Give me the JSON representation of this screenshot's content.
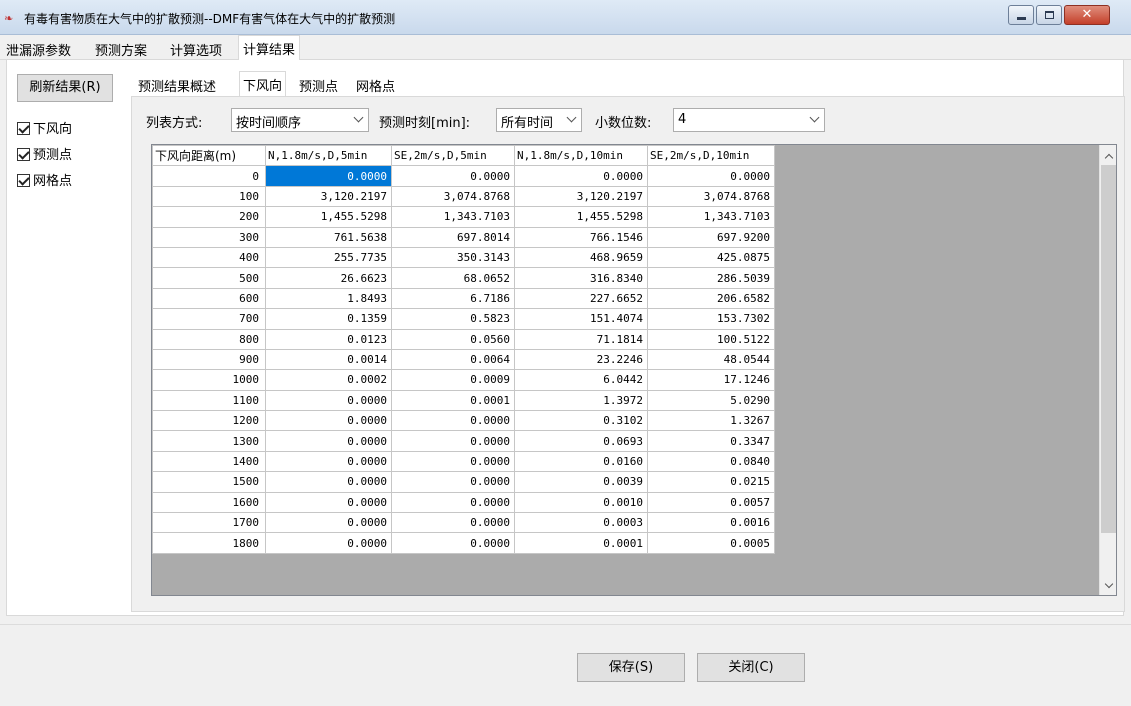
{
  "window": {
    "title": "有毒有害物质在大气中的扩散预测--DMF有害气体在大气中的扩散预测",
    "app_icon": "app-logo-icon",
    "minimize_glyph": "",
    "maximize_glyph": "",
    "close_glyph": "✕"
  },
  "main_tabs": [
    {
      "label": "泄漏源参数"
    },
    {
      "label": "预测方案"
    },
    {
      "label": "计算选项"
    },
    {
      "label": "计算结果"
    }
  ],
  "sidebar": {
    "refresh_label": "刷新结果(R)",
    "checkboxes": [
      {
        "label": "下风向",
        "checked": true
      },
      {
        "label": "预测点",
        "checked": true
      },
      {
        "label": "网格点",
        "checked": true
      }
    ]
  },
  "sub_tabs": [
    {
      "label": "预测结果概述"
    },
    {
      "label": "下风向"
    },
    {
      "label": "预测点"
    },
    {
      "label": "网格点"
    }
  ],
  "filters": {
    "list_mode_label": "列表方式:",
    "list_mode_value": "按时间顺序",
    "time_label": "预测时刻[min]:",
    "time_value": "所有时间",
    "decimals_label": "小数位数:",
    "decimals_value": "4"
  },
  "table": {
    "columns": [
      "下风向距离(m)",
      "N,1.8m/s,D,5min",
      "SE,2m/s,D,5min",
      "N,1.8m/s,D,10min",
      "SE,2m/s,D,10min"
    ],
    "rows": [
      [
        "0",
        "0.0000",
        "0.0000",
        "0.0000",
        "0.0000"
      ],
      [
        "100",
        "3,120.2197",
        "3,074.8768",
        "3,120.2197",
        "3,074.8768"
      ],
      [
        "200",
        "1,455.5298",
        "1,343.7103",
        "1,455.5298",
        "1,343.7103"
      ],
      [
        "300",
        "761.5638",
        "697.8014",
        "766.1546",
        "697.9200"
      ],
      [
        "400",
        "255.7735",
        "350.3143",
        "468.9659",
        "425.0875"
      ],
      [
        "500",
        "26.6623",
        "68.0652",
        "316.8340",
        "286.5039"
      ],
      [
        "600",
        "1.8493",
        "6.7186",
        "227.6652",
        "206.6582"
      ],
      [
        "700",
        "0.1359",
        "0.5823",
        "151.4074",
        "153.7302"
      ],
      [
        "800",
        "0.0123",
        "0.0560",
        "71.1814",
        "100.5122"
      ],
      [
        "900",
        "0.0014",
        "0.0064",
        "23.2246",
        "48.0544"
      ],
      [
        "1000",
        "0.0002",
        "0.0009",
        "6.0442",
        "17.1246"
      ],
      [
        "1100",
        "0.0000",
        "0.0001",
        "1.3972",
        "5.0290"
      ],
      [
        "1200",
        "0.0000",
        "0.0000",
        "0.3102",
        "1.3267"
      ],
      [
        "1300",
        "0.0000",
        "0.0000",
        "0.0693",
        "0.3347"
      ],
      [
        "1400",
        "0.0000",
        "0.0000",
        "0.0160",
        "0.0840"
      ],
      [
        "1500",
        "0.0000",
        "0.0000",
        "0.0039",
        "0.0215"
      ],
      [
        "1600",
        "0.0000",
        "0.0000",
        "0.0010",
        "0.0057"
      ],
      [
        "1700",
        "0.0000",
        "0.0000",
        "0.0003",
        "0.0016"
      ],
      [
        "1800",
        "0.0000",
        "0.0000",
        "0.0001",
        "0.0005"
      ]
    ]
  },
  "buttons": {
    "save": "保存(S)",
    "close": "关闭(C)"
  },
  "colors": {
    "selection": "#0078d7",
    "table_empty_area": "#ababab"
  }
}
